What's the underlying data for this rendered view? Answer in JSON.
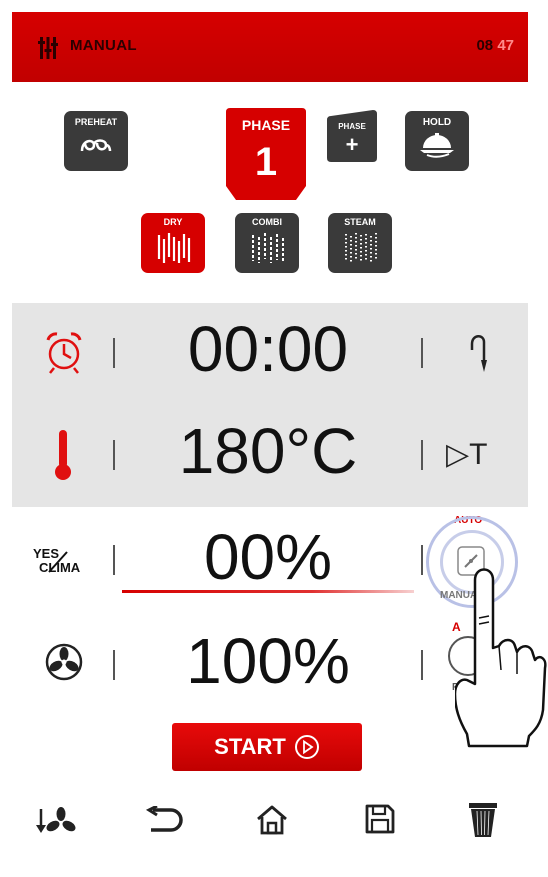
{
  "header": {
    "title": "MANUAL",
    "clock_hour": "08",
    "clock_min": "47"
  },
  "modes": {
    "preheat": "PREHEAT",
    "phase_label": "PHASE",
    "phase_number": "1",
    "add_phase_label": "PHASE",
    "add_phase_symbol": "+",
    "hold": "HOLD",
    "dry": "DRY",
    "combi": "COMBI",
    "steam": "STEAM"
  },
  "settings": {
    "time": "00:00",
    "temperature": "180°C",
    "delta_t": "▷T",
    "yes_label": "YES",
    "clima_label": "CLIMA",
    "humidity": "00%",
    "auto_label": "AUTO",
    "manual_label": "MANUAL",
    "fan_speed": "100%",
    "auto_label_2": "A",
    "p_label": "P"
  },
  "actions": {
    "start": "START"
  },
  "colors": {
    "accent": "#d60000",
    "tile": "#3a3a3a",
    "band": "#e5e5e5"
  }
}
